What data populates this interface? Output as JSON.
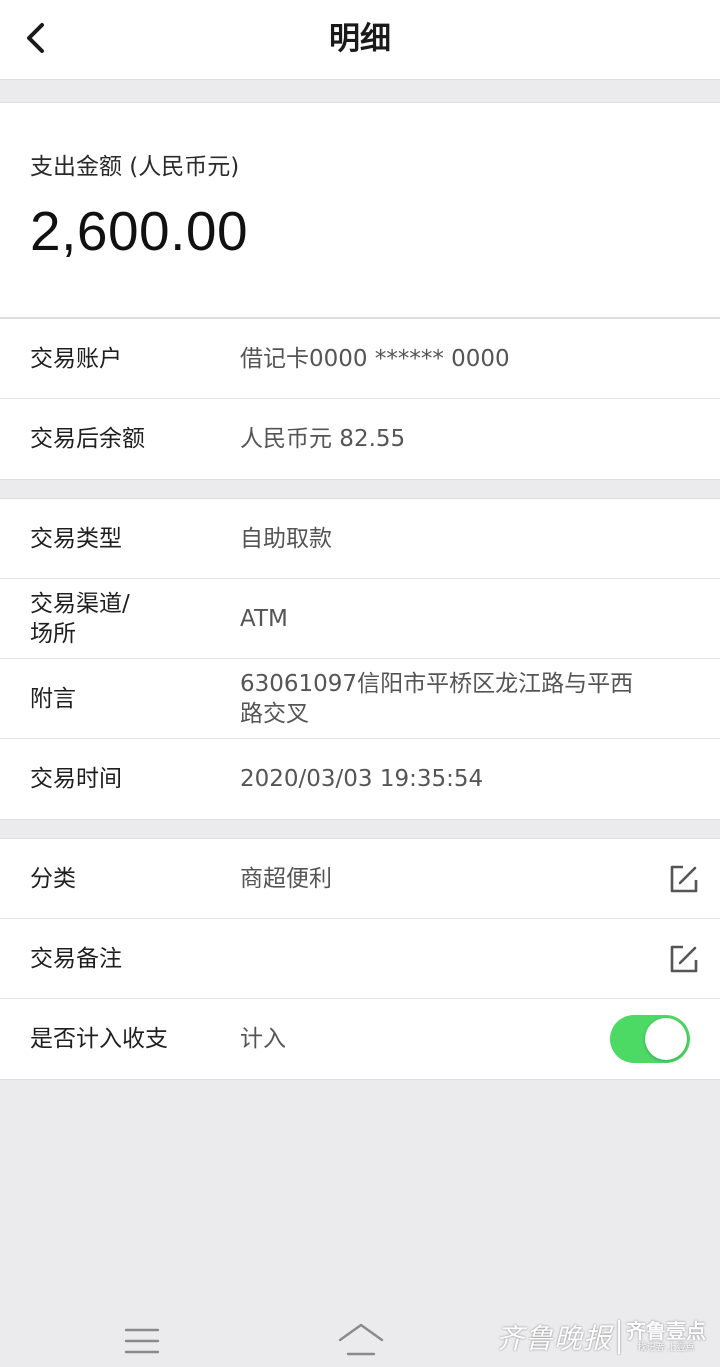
{
  "header": {
    "title": "明细",
    "back_icon": "chevron-left-icon"
  },
  "amount": {
    "label": "支出金额 (人民币元)",
    "value": "2,600.00"
  },
  "account_section": [
    {
      "label": "交易账户",
      "value": "借记卡0000 ****** 0000"
    },
    {
      "label": "交易后余额",
      "value": "人民币元 82.55"
    }
  ],
  "transaction_section": {
    "type_label": "交易类型",
    "type_value": "自助取款",
    "channel_label_line1": "交易渠道/",
    "channel_label_line2": "场所",
    "channel_value": "ATM",
    "note_label": "附言",
    "note_value_line1": "63061097信阳市平桥区龙江路与平西",
    "note_value_line2": "路交叉",
    "time_label": "交易时间",
    "time_value": "2020/03/03 19:35:54"
  },
  "category_section": {
    "category_label": "分类",
    "category_value": "商超便利",
    "remark_label": "交易备注",
    "remark_value": "",
    "include_label": "是否计入收支",
    "include_value": "计入",
    "include_enabled": true
  },
  "watermark": {
    "main": "齐鲁晚报",
    "sub": "齐鲁壹点",
    "tiny": "找记者·上壹点"
  },
  "colors": {
    "toggle_on": "#4cd964",
    "background": "#ebebed",
    "card": "#ffffff"
  }
}
